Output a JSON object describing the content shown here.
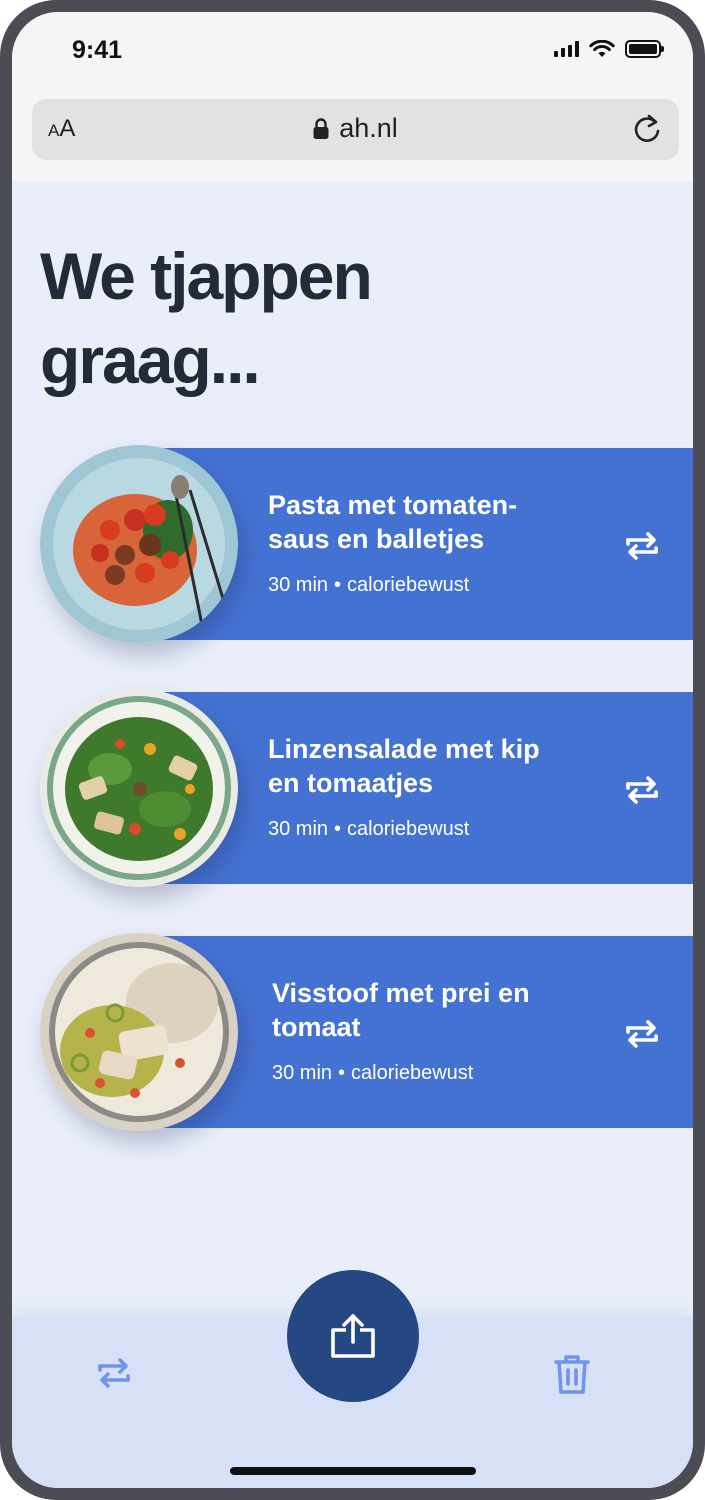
{
  "status_bar": {
    "time": "9:41"
  },
  "browser": {
    "text_size_label_small": "A",
    "text_size_label_large": "A",
    "url": "ah.nl"
  },
  "headline": "We tjappen graag...",
  "recipes": [
    {
      "title": "Pasta met tomaten-saus en balletjes",
      "time": "30 min",
      "tag": "caloriebewust",
      "plate": "pasta-plate"
    },
    {
      "title": "Linzensalade met kip en tomaatjes",
      "time": "30 min",
      "tag": "caloriebewust",
      "plate": "salad-plate"
    },
    {
      "title": "Visstoof met prei en tomaat",
      "time": "30 min",
      "tag": "caloriebewust",
      "plate": "stew-plate"
    }
  ],
  "meta_separator": "•",
  "colors": {
    "accent_band": "#4472d3",
    "fab": "#254883",
    "background": "#e9eefa",
    "bottom_bar": "#d6e0f7",
    "bar_icons": "#6f96e6"
  },
  "icons": {
    "swap": "swap-arrows-icon",
    "share": "share-icon",
    "trash": "trash-icon",
    "lock": "lock-icon",
    "reload": "reload-icon"
  }
}
